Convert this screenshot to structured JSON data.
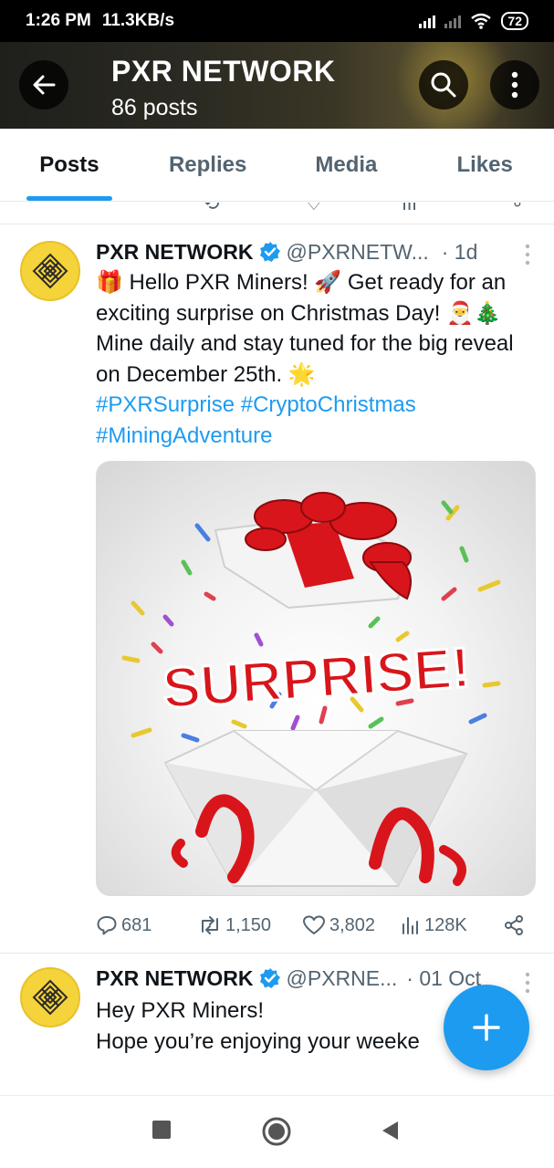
{
  "status_bar": {
    "time": "1:26 PM",
    "speed": "11.3KB/s",
    "battery": "72"
  },
  "header": {
    "title": "PXR NETWORK",
    "subtitle": "86 posts"
  },
  "tabs": [
    {
      "label": "Posts",
      "active": true
    },
    {
      "label": "Replies",
      "active": false
    },
    {
      "label": "Media",
      "active": false
    },
    {
      "label": "Likes",
      "active": false
    }
  ],
  "posts": [
    {
      "name": "PXR NETWORK",
      "handle": "@PXRNETW...",
      "time": "· 1d",
      "text_parts": [
        "🎁 Hello PXR Miners! 🚀 Get ready for an exciting surprise on Christmas Day! 🎅🎄 Mine daily and stay tuned for the big reveal on December 25th. 🌟"
      ],
      "hashtags": "#PXRSurprise #CryptoChristmas #MiningAdventure",
      "image_text": "SURPRISE!",
      "replies": "681",
      "reposts": "1,150",
      "likes": "3,802",
      "views": "128K"
    },
    {
      "name": "PXR NETWORK",
      "handle": "@PXRNE...",
      "time": "· 01 Oct",
      "line1": "Hey PXR Miners!",
      "line2": "Hope you’re enjoying your weeke"
    }
  ],
  "colors": {
    "accent": "#1d9bf0",
    "text": "#0f1419",
    "muted": "#536471",
    "avatar": "#f5d33a",
    "ribbon": "#d8151b"
  },
  "icons": [
    "back-arrow-icon",
    "search-icon",
    "more-vertical-icon",
    "verified-badge-icon",
    "reply-icon",
    "repost-icon",
    "like-icon",
    "views-icon",
    "share-icon",
    "compose-plus-icon"
  ]
}
